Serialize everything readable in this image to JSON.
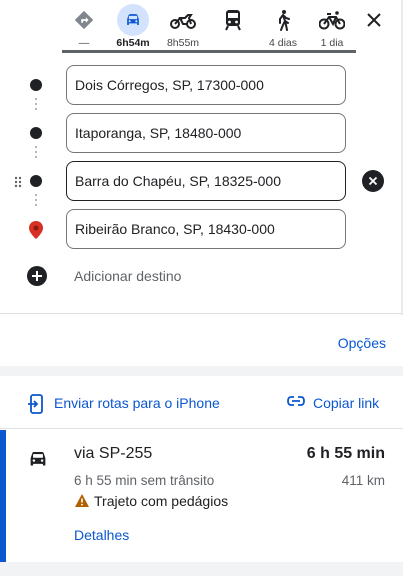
{
  "travel_modes": [
    {
      "id": "best",
      "icon": "diamond-turn-icon",
      "label": "—",
      "active": false
    },
    {
      "id": "car",
      "icon": "car-icon",
      "label": "6h54m",
      "active": true
    },
    {
      "id": "motorcycle",
      "icon": "motorcycle-icon",
      "label": "8h55m",
      "active": false
    },
    {
      "id": "transit",
      "icon": "train-icon",
      "label": "",
      "active": false
    },
    {
      "id": "walk",
      "icon": "walking-icon",
      "label": "4 dias",
      "active": false
    },
    {
      "id": "bike",
      "icon": "bicycle-icon",
      "label": "1 dia",
      "active": false
    }
  ],
  "waypoints": [
    {
      "value": "Dois Córregos, SP, 17300-000"
    },
    {
      "value": "Itaporanga, SP, 18480-000"
    },
    {
      "value": "Barra do Chapéu, SP, 18325-000"
    },
    {
      "value": "Ribeirão Branco, SP, 18430-000"
    }
  ],
  "add_destination": "Adicionar destino",
  "options_label": "Opções",
  "share": {
    "send_label": "Enviar rotas para o iPhone",
    "copy_label": "Copiar link"
  },
  "route": {
    "via": "via SP-255",
    "duration": "6 h 55 min",
    "no_traffic": "6 h 55 min sem trânsito",
    "distance": "411 km",
    "warning": "Trajeto com pedágios",
    "details_label": "Detalhes"
  },
  "colors": {
    "accent": "#0b57d0",
    "active_mode_bg": "#d3e3fd",
    "destination_pin": "#d93025",
    "warning": "#b06000"
  }
}
